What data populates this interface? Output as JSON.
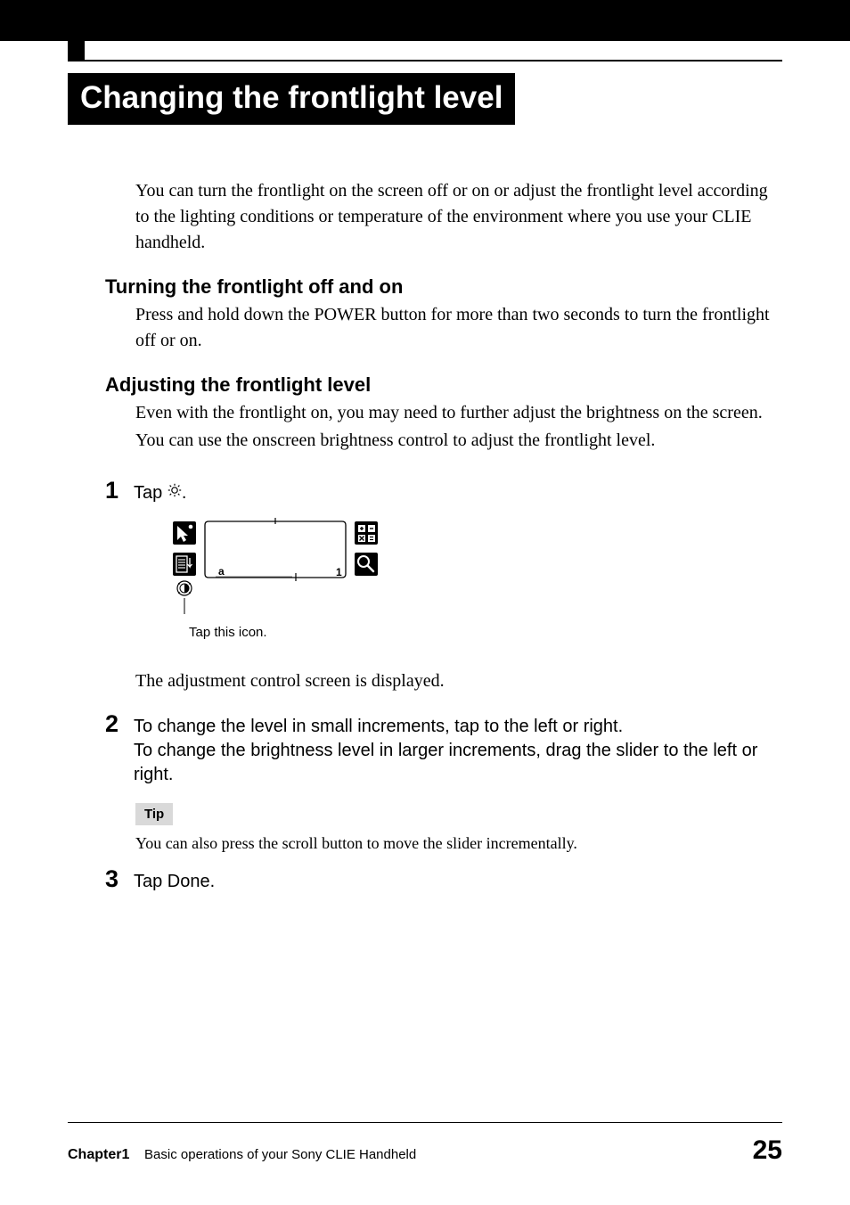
{
  "title": "Changing the frontlight level",
  "intro": "You can turn the frontlight on the screen off or on or adjust the frontlight level according to the lighting conditions or temperature of the environment where you use your CLIE handheld.",
  "section1": {
    "heading": "Turning the frontlight off and on",
    "body": "Press and hold down the POWER button for more than two seconds to turn the frontlight off or on."
  },
  "section2": {
    "heading": "Adjusting the frontlight level",
    "body1": "Even with the frontlight on, you may need to further adjust the brightness on the screen.",
    "body2": "You can use the onscreen brightness control to adjust the frontlight level."
  },
  "steps": {
    "s1": {
      "num": "1",
      "text_pre": "Tap ",
      "text_post": "."
    },
    "caption": "Tap this icon.",
    "adjust_text": "The adjustment control screen is displayed.",
    "s2": {
      "num": "2",
      "text": "To change the level in small increments, tap to the left or right.\nTo change the brightness level in larger increments, drag the slider to the left or right."
    },
    "tip_label": "Tip",
    "tip_text": "You can also press the scroll button to move the slider incrementally.",
    "s3": {
      "num": "3",
      "text": "Tap Done."
    }
  },
  "graffiti": {
    "letter_a": "a",
    "digit_1": "1"
  },
  "footer": {
    "chapter": "Chapter1",
    "subtitle": "Basic operations of your Sony CLIE Handheld",
    "page": "25"
  },
  "icons": {
    "sun": "brightness-icon",
    "home": "home-icon",
    "menu": "menu-icon",
    "calc": "calculator-icon",
    "find": "find-icon",
    "contrast": "contrast-icon"
  }
}
